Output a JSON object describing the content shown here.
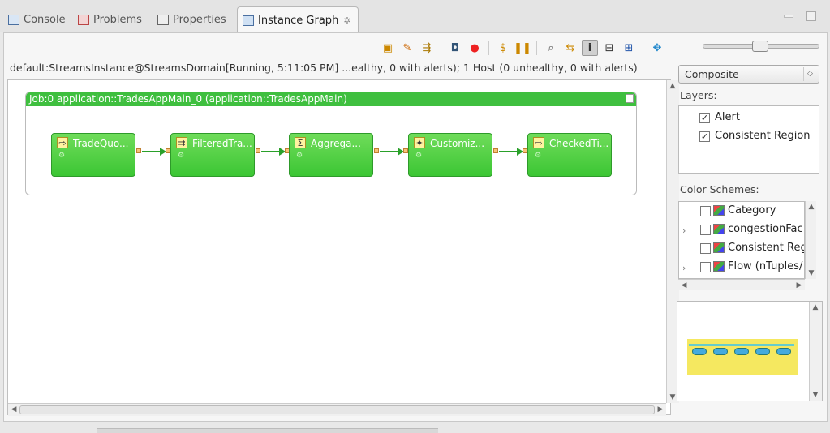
{
  "tabs": [
    {
      "label": "Console",
      "icon": "console-icon"
    },
    {
      "label": "Problems",
      "icon": "problems-icon"
    },
    {
      "label": "Properties",
      "icon": "properties-icon"
    },
    {
      "label": "Instance Graph",
      "icon": "instance-graph-icon",
      "active": true,
      "close": "✲"
    }
  ],
  "status_line": "default:StreamsInstance@StreamsDomain[Running, 5:11:05 PM]   ...ealthy, 0 with alerts);  1 Host (0 unhealthy, 0 with alerts)",
  "job": {
    "title": "Job:0 application::TradesAppMain_0  (application::TradesAppMain)",
    "operators": [
      {
        "label": "TradeQuo...",
        "icon": "⇨"
      },
      {
        "label": "FilteredTra...",
        "icon": "⇉"
      },
      {
        "label": "Aggrega...",
        "icon": "Σ"
      },
      {
        "label": "Customiz...",
        "icon": "✦"
      },
      {
        "label": "CheckedTi...",
        "icon": "⇨"
      }
    ]
  },
  "side": {
    "composite_select": "Composite",
    "layers_label": "Layers:",
    "layers": [
      {
        "label": "Alert",
        "checked": "✓"
      },
      {
        "label": "Consistent Region",
        "checked": "✓"
      }
    ],
    "color_schemes_label": "Color Schemes:",
    "color_schemes": [
      {
        "label": "Category"
      },
      {
        "label": "congestionFac"
      },
      {
        "label": "Consistent Reg"
      },
      {
        "label": "Flow (nTuples/"
      }
    ]
  },
  "colors": {
    "operator_green": "#3cc634",
    "job_header_green": "#3fbf3f",
    "overview_yellow": "#f5e860"
  }
}
